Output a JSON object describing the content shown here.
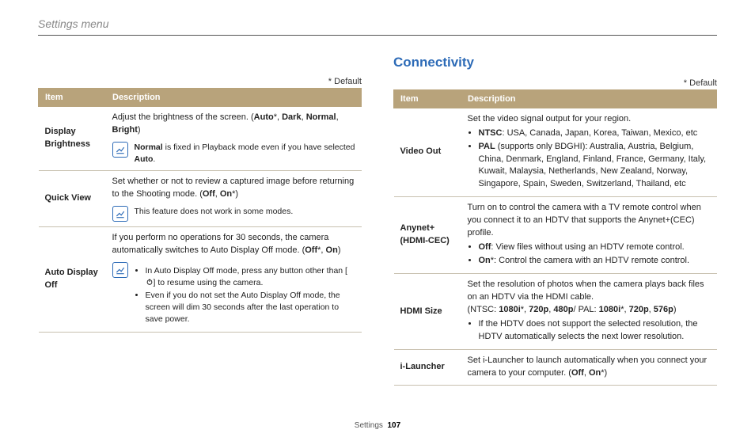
{
  "breadcrumb": "Settings menu",
  "default_note": "* Default",
  "footer": {
    "section": "Settings",
    "page": "107"
  },
  "left": {
    "headers": {
      "item": "Item",
      "desc": "Description"
    },
    "rows": {
      "display_brightness": {
        "item": "Display Brightness",
        "desc_pre": "Adjust the brightness of the screen. (",
        "opt1": "Auto",
        "opt2": "Dark",
        "opt3": "Normal",
        "opt4": "Bright",
        "desc_close": ")",
        "note_bold": "Normal",
        "note_rest": " is fixed in Playback mode even if you have selected ",
        "note_bold2": "Auto",
        "note_dot": "."
      },
      "quick_view": {
        "item": "Quick View",
        "desc_pre": "Set whether or not to review a captured image before returning to the Shooting mode. (",
        "off": "Off",
        "on": "On",
        "desc_close": "*)",
        "note": "This feature does not work in some modes."
      },
      "auto_display_off": {
        "item": "Auto Display Off",
        "desc_pre": "If you perform no operations for 30 seconds, the camera automatically switches to Auto Display Off mode. (",
        "off": "Off",
        "on": "On",
        "desc_close": ")",
        "bullet1_pre": "In Auto Display Off mode, press any button other than [",
        "bullet1_post": "] to resume using the camera.",
        "bullet2": "Even if you do not set the Auto Display Off mode, the screen will dim 30 seconds after the last operation to save power."
      }
    }
  },
  "right": {
    "title": "Connectivity",
    "headers": {
      "item": "Item",
      "desc": "Description"
    },
    "rows": {
      "video_out": {
        "item": "Video Out",
        "line1": "Set the video signal output for your region.",
        "ntsc_label": "NTSC",
        "ntsc_text": ": USA, Canada, Japan, Korea, Taiwan, Mexico, etc",
        "pal_label": "PAL",
        "pal_text": " (supports only BDGHI): Australia, Austria, Belgium, China, Denmark, England, Finland, France, Germany, Italy, Kuwait, Malaysia, Netherlands, New Zealand, Norway, Singapore, Spain, Sweden, Switzerland, Thailand, etc"
      },
      "anynet": {
        "item": "Anynet+ (HDMI-CEC)",
        "line1": "Turn on to control the camera with a TV remote control when you connect it to an HDTV that supports the Anynet+(CEC) profile.",
        "off_label": "Off",
        "off_text": ": View files without using an HDTV remote control.",
        "on_label": "On",
        "on_text": "*: Control the camera with an HDTV remote control."
      },
      "hdmi_size": {
        "item": "HDMI Size",
        "line1": "Set the resolution of photos when the camera plays back files on an HDTV via the HDMI cable.",
        "ntsc_pre": "(NTSC: ",
        "n1": "1080i",
        "n2": "720p",
        "n3": "480p",
        "pal_pre": "/ PAL: ",
        "p1": "1080i",
        "p2": "720p",
        "p3": "576p",
        "close": ")",
        "bullet": "If the HDTV does not support the selected resolution, the HDTV automatically selects the next lower resolution."
      },
      "ilauncher": {
        "item": "i-Launcher",
        "desc_pre": "Set i-Launcher to launch automatically when you connect your camera to your computer. (",
        "off": "Off",
        "on": "On",
        "desc_close": "*)"
      }
    }
  }
}
